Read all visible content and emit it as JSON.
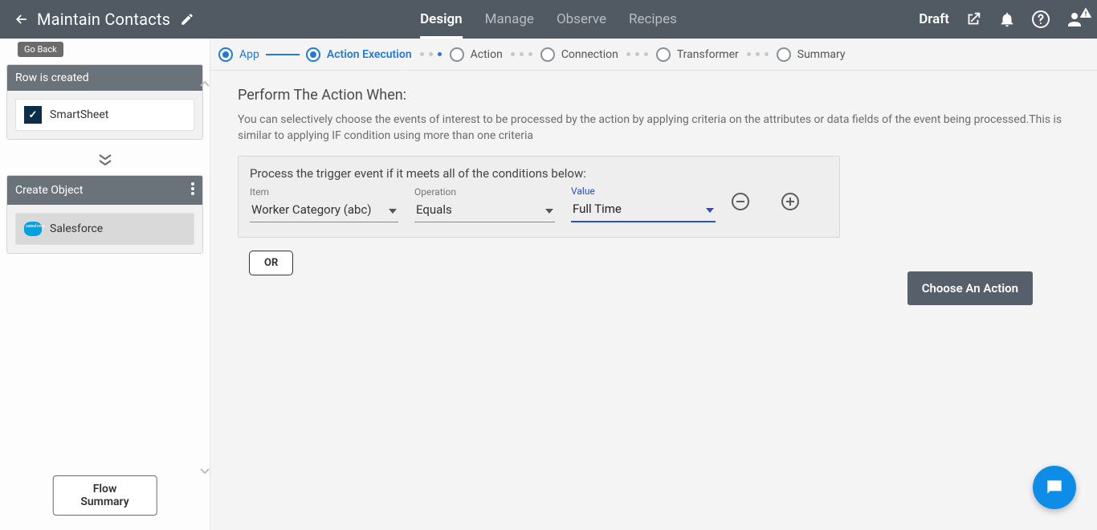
{
  "header": {
    "title": "Maintain Contacts",
    "nav": [
      "Design",
      "Manage",
      "Observe",
      "Recipes"
    ],
    "nav_active_index": 0,
    "status": "Draft"
  },
  "sidebar": {
    "goback": "Go Back",
    "trigger_card": {
      "title": "Row is created",
      "app": "SmartSheet"
    },
    "action_card": {
      "title": "Create Object",
      "app": "Salesforce"
    },
    "flow_summary": "Flow Summary"
  },
  "stepper": {
    "steps": [
      "App",
      "Action Execution",
      "Action",
      "Connection",
      "Transformer",
      "Summary"
    ],
    "done_index": 0,
    "active_index": 1
  },
  "content": {
    "heading": "Perform The Action When:",
    "description": "You can selectively choose the events of interest to be processed by the action by applying criteria on the attributes or data fields of the event being processed.This is similar to applying IF condition using more than one criteria",
    "cond_title": "Process the trigger event if it meets all of the conditions below:",
    "labels": {
      "item": "Item",
      "operation": "Operation",
      "value": "Value"
    },
    "condition": {
      "item": "Worker Category (abc)",
      "operation": "Equals",
      "value": "Full Time"
    },
    "or": "OR",
    "choose_action": "Choose An Action"
  }
}
